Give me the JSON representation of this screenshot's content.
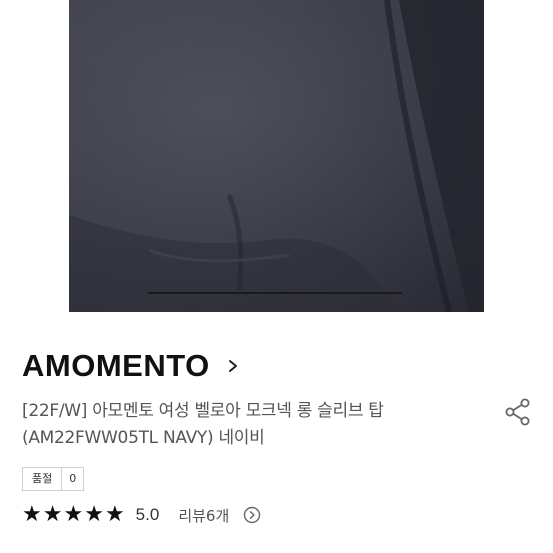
{
  "brand": {
    "name": "AMOMENTO",
    "chevron_icon": "chevron-right-icon"
  },
  "product": {
    "title_line1": "[22F/W] 아모멘토 여성 벨로아 모크넥 롱 슬리브 탑",
    "title_line2": "(AM22FWW05TL NAVY) 네이비",
    "image_icon": "product-photo",
    "image_color": "#3a3b47"
  },
  "quality": {
    "label": "품절",
    "value": "0"
  },
  "rating": {
    "stars": [
      "★",
      "★",
      "★",
      "★",
      "★"
    ],
    "value": "5.0",
    "reviews": "리뷰6개",
    "star_count": 5,
    "max_stars": 5
  },
  "icons": {
    "share": "share-icon",
    "play": "play-circle-icon"
  },
  "colors": {
    "text_primary": "#111111",
    "text_secondary": "#555555",
    "border": "#cfcfcf"
  }
}
